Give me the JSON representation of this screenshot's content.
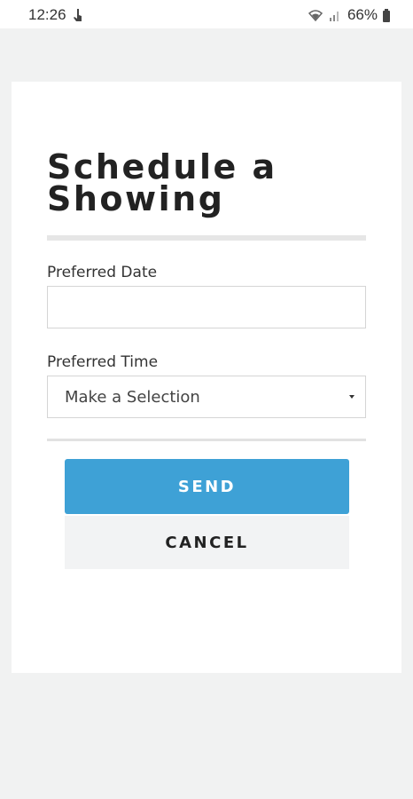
{
  "status_bar": {
    "time": "12:26",
    "battery_percent": "66%",
    "icons": [
      "touch-icon",
      "wifi-icon",
      "signal-icon",
      "battery-icon"
    ]
  },
  "form": {
    "title": "Schedule a Showing",
    "date_label": "Preferred Date",
    "date_value": "",
    "time_label": "Preferred Time",
    "time_select_value": "Make a Selection"
  },
  "actions": {
    "send_label": "SEND",
    "cancel_label": "CANCEL"
  },
  "colors": {
    "send_button": "#3ea1d6",
    "cancel_button": "#f2f3f4",
    "page_background": "#f1f2f2"
  }
}
